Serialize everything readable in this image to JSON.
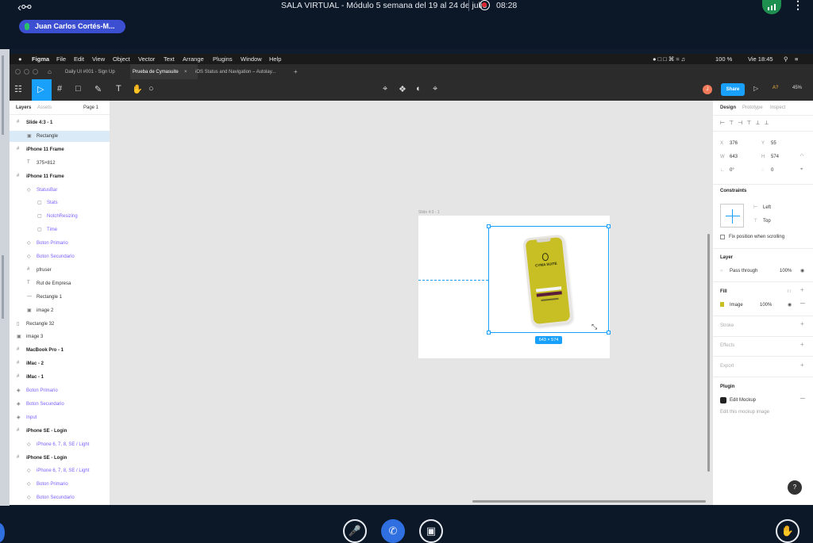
{
  "meeting": {
    "title": "SALA VIRTUAL - Módulo 5 semana del 19 al 24 de julio",
    "timer": "08:28",
    "presenter": "Juan Carlos Cortés-M...",
    "icons": {
      "exit": "exit-room-icon",
      "signal": "connection-signal-icon",
      "more": "more-options-icon"
    },
    "controls": [
      "mute-microphone-icon",
      "phone-call-icon",
      "camera-off-icon",
      "raise-hand-icon"
    ]
  },
  "mac_menu": {
    "apple": "",
    "app": "Figma",
    "items": [
      "File",
      "Edit",
      "View",
      "Object",
      "Vector",
      "Text",
      "Arrange",
      "Plugins",
      "Window",
      "Help"
    ],
    "battery": "100 %",
    "clock": "Vie 18:45"
  },
  "figma_tabs": {
    "tabs": [
      "Daily UI #001 - Sign Up",
      "Prueba de Cymasuite",
      "iOS Status and Navigation – Autolay..."
    ],
    "plus": "+"
  },
  "toolbar": {
    "share": "Share",
    "avatar": "J",
    "aa": "A?",
    "zoom": "45%"
  },
  "layers": {
    "tab_layers": "Layers",
    "tab_assets": "Assets",
    "page": "Page 1",
    "rows": [
      {
        "label": "Slide 4:3 - 1",
        "indent": 0,
        "icon": "#",
        "style": "b"
      },
      {
        "label": "Rectangle",
        "indent": 1,
        "icon": "▣",
        "style": "sel"
      },
      {
        "label": "iPhone 11 Frame",
        "indent": 0,
        "icon": "#",
        "style": "b"
      },
      {
        "label": "375×812",
        "indent": 1,
        "icon": "T",
        "style": ""
      },
      {
        "label": "iPhone 11 Frame",
        "indent": 0,
        "icon": "#",
        "style": "b"
      },
      {
        "label": "StatusBar",
        "indent": 1,
        "icon": "◇",
        "style": "p"
      },
      {
        "label": "Stats",
        "indent": 2,
        "icon": "▢",
        "style": "p"
      },
      {
        "label": "NotchResizing",
        "indent": 2,
        "icon": "▢",
        "style": "p"
      },
      {
        "label": "Time",
        "indent": 2,
        "icon": "▢",
        "style": "p"
      },
      {
        "label": "Boton Primario",
        "indent": 1,
        "icon": "◇",
        "style": "p"
      },
      {
        "label": "Boton Secundario",
        "indent": 1,
        "icon": "◇",
        "style": "p"
      },
      {
        "label": "pfruser",
        "indent": 1,
        "icon": "#",
        "style": ""
      },
      {
        "label": "Rut de Empresa",
        "indent": 1,
        "icon": "T",
        "style": ""
      },
      {
        "label": "Rectangle 1",
        "indent": 1,
        "icon": "—",
        "style": ""
      },
      {
        "label": "image 2",
        "indent": 1,
        "icon": "▣",
        "style": ""
      },
      {
        "label": "Rectangle 32",
        "indent": 0,
        "icon": "▯",
        "style": ""
      },
      {
        "label": "image 3",
        "indent": 0,
        "icon": "▣",
        "style": ""
      },
      {
        "label": "MacBook Pro - 1",
        "indent": 0,
        "icon": "#",
        "style": "b"
      },
      {
        "label": "iMac - 2",
        "indent": 0,
        "icon": "#",
        "style": "b"
      },
      {
        "label": "iMac - 1",
        "indent": 0,
        "icon": "#",
        "style": "b"
      },
      {
        "label": "Boton Primario",
        "indent": 0,
        "icon": "◈",
        "style": "p"
      },
      {
        "label": "Boton Secundario",
        "indent": 0,
        "icon": "◈",
        "style": "p"
      },
      {
        "label": "Input",
        "indent": 0,
        "icon": "◈",
        "style": "p"
      },
      {
        "label": "iPhone SE - Login",
        "indent": 0,
        "icon": "#",
        "style": "b"
      },
      {
        "label": "iPhone 6, 7, 8, SE / Light",
        "indent": 1,
        "icon": "◇",
        "style": "p"
      },
      {
        "label": "iPhone SE - Login",
        "indent": 0,
        "icon": "#",
        "style": "b"
      },
      {
        "label": "iPhone 6, 7, 8, SE / Light",
        "indent": 1,
        "icon": "◇",
        "style": "p"
      },
      {
        "label": "Boton Primario",
        "indent": 1,
        "icon": "◇",
        "style": "p"
      },
      {
        "label": "Boton Secundario",
        "indent": 1,
        "icon": "◇",
        "style": "p"
      }
    ]
  },
  "canvas": {
    "frame_label": "Slide 4:3 - 1",
    "dims": "643 × 574",
    "mockup_logo": "CYMA SUITE"
  },
  "design": {
    "tabs": [
      "Design",
      "Prototype",
      "Inspect"
    ],
    "x": "376",
    "y": "55",
    "w": "643",
    "h": "574",
    "rotation": "0°",
    "radius": "0",
    "labels": {
      "x": "X",
      "y": "Y",
      "w": "W",
      "h": "H"
    },
    "constraints_title": "Constraints",
    "constraint_h": "Left",
    "constraint_v": "Top",
    "fix_position": "Fix position when scrolling",
    "layer_title": "Layer",
    "blend": "Pass through",
    "layer_opacity": "100%",
    "fill_title": "Fill",
    "fill_type": "Image",
    "fill_opacity": "100%",
    "stroke": "Stroke",
    "effects": "Effects",
    "export": "Export",
    "plugin_title": "Plugin",
    "plugin_name": "Edit Mockup",
    "plugin_desc": "Edit this mockup image",
    "help": "?"
  }
}
